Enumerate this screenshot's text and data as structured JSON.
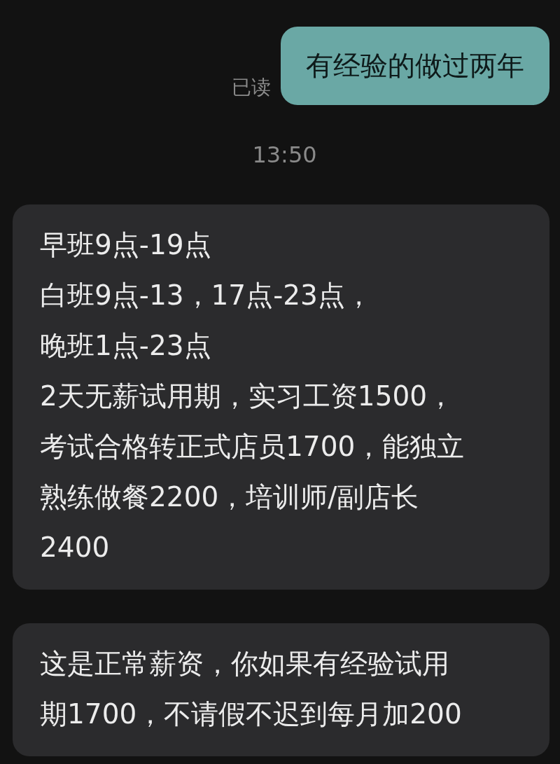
{
  "messages": [
    {
      "kind": "outgoing",
      "text": "有经验的做过两年",
      "receipt": "已读"
    },
    {
      "kind": "timestamp",
      "text": "13:50"
    },
    {
      "kind": "incoming",
      "lines": [
        "早班9点-19点",
        "白班9点-13，17点-23点，",
        "晚班1点-23点",
        "2天无薪试用期，实习工资1500，",
        "考试合格转正式店员1700，能独立",
        "熟练做餐2200，培训师/副店长",
        "2400"
      ]
    },
    {
      "kind": "incoming",
      "lines": [
        "这是正常薪资，你如果有经验试用",
        "期1700，不请假不迟到每月加200"
      ]
    }
  ]
}
